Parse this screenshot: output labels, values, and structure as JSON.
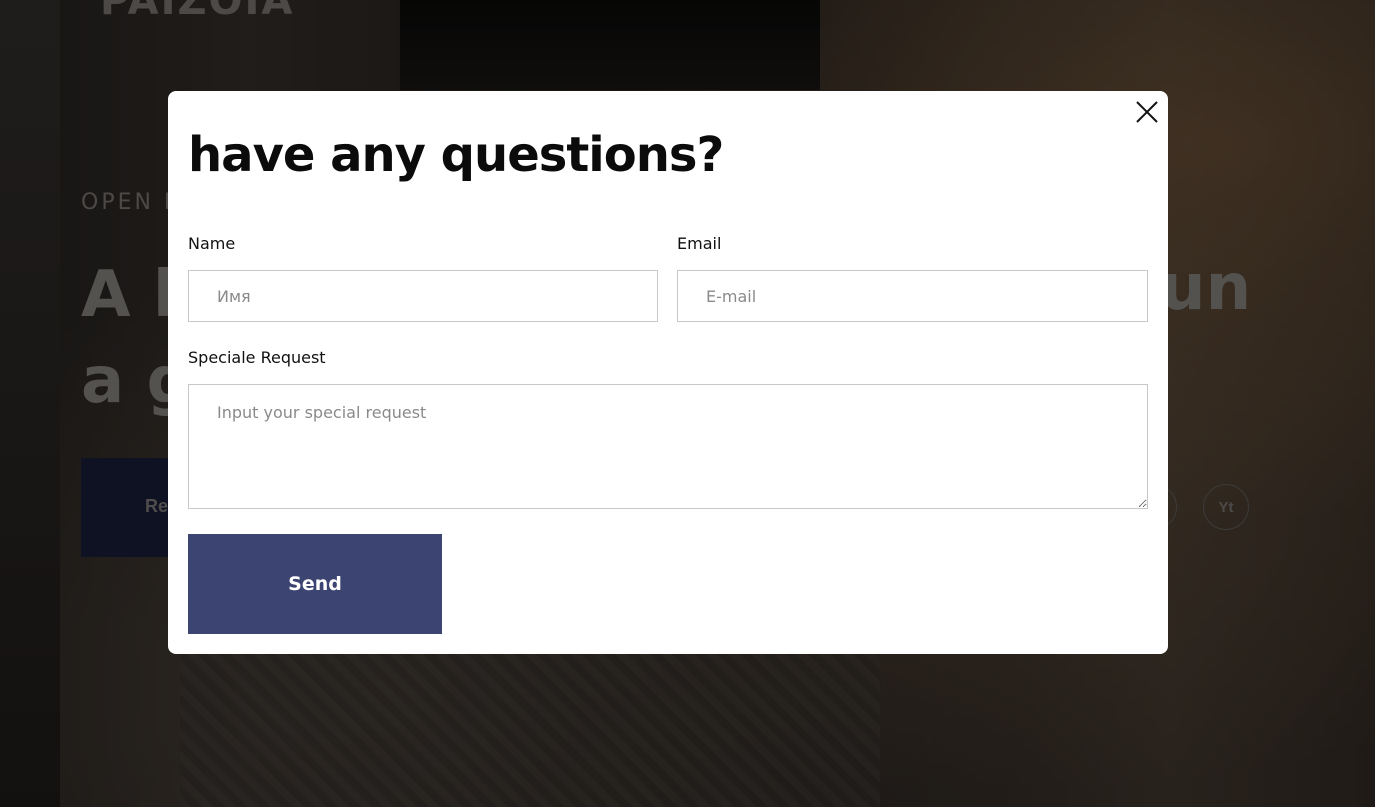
{
  "background": {
    "logo": "PAIZOIA",
    "eyebrow": "OPEN E",
    "heading_line1": "A b",
    "heading_line2": "a g",
    "heading_right": "un",
    "cta_label": "Re",
    "social": [
      "",
      "Yt"
    ]
  },
  "modal": {
    "title": "have any questions?",
    "close_icon": "close-icon",
    "fields": {
      "name_label": "Name",
      "name_placeholder": "Имя",
      "email_label": "Email",
      "email_placeholder": "E-mail",
      "request_label": "Speciale Request",
      "request_placeholder": "Input your special request"
    },
    "send_label": "Send"
  },
  "colors": {
    "button": "#3c4572",
    "overlay": "rgba(0,0,0,0.45)"
  }
}
